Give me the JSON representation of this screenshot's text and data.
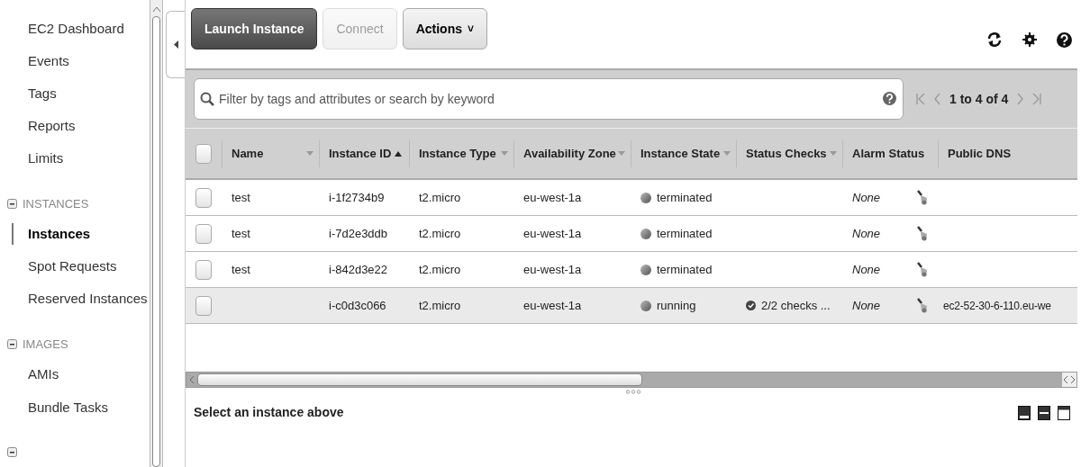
{
  "sidebar": {
    "items": [
      {
        "kind": "link",
        "label": "EC2 Dashboard",
        "selected": false
      },
      {
        "kind": "link",
        "label": "Events",
        "selected": false
      },
      {
        "kind": "link",
        "label": "Tags",
        "selected": false
      },
      {
        "kind": "link",
        "label": "Reports",
        "selected": false
      },
      {
        "kind": "link",
        "label": "Limits",
        "selected": false
      },
      {
        "kind": "group",
        "label": "INSTANCES",
        "expanded": true
      },
      {
        "kind": "link",
        "label": "Instances",
        "selected": true
      },
      {
        "kind": "link",
        "label": "Spot Requests",
        "selected": false
      },
      {
        "kind": "link",
        "label": "Reserved Instances",
        "selected": false
      },
      {
        "kind": "group",
        "label": "IMAGES",
        "expanded": true
      },
      {
        "kind": "link",
        "label": "AMIs",
        "selected": false
      },
      {
        "kind": "link",
        "label": "Bundle Tasks",
        "selected": false
      },
      {
        "kind": "group",
        "expanded": true
      }
    ]
  },
  "toolbar": {
    "buttons": [
      {
        "kind": "primary",
        "label": "Launch Instance",
        "disabled": false
      },
      {
        "kind": "plain",
        "label": "Connect",
        "disabled": true
      },
      {
        "kind": "menu",
        "label": "Actions",
        "caret": "˅",
        "disabled": false
      }
    ]
  },
  "filter": {
    "placeholder": "Filter by tags and attributes or search by keyword"
  },
  "pagination": {
    "label": "1 to 4 of 4"
  },
  "table": {
    "columns": [
      {
        "label": "Name",
        "sorted_ascending": false,
        "has_menu": true
      },
      {
        "label": "Instance ID",
        "sorted_ascending": true,
        "has_menu": false
      },
      {
        "label": "Instance Type",
        "sorted_ascending": false,
        "has_menu": true
      },
      {
        "label": "Availability Zone",
        "sorted_ascending": false,
        "has_menu": true
      },
      {
        "label": "Instance State",
        "sorted_ascending": false,
        "has_menu": true
      },
      {
        "label": "Status Checks",
        "sorted_ascending": false,
        "has_menu": true
      },
      {
        "label": "Alarm Status",
        "sorted_ascending": false,
        "has_menu": false
      },
      {
        "label": "Public DNS",
        "sorted_ascending": false,
        "has_menu": false
      }
    ],
    "select_all": {
      "checked": false
    },
    "rows": [
      {
        "highlighted": false,
        "checked": false,
        "name": "test",
        "id": "i-1f2734b9",
        "type": "t2.micro",
        "zone": "eu-west-1a",
        "state": "terminated",
        "alarm": "None"
      },
      {
        "highlighted": false,
        "checked": false,
        "name": "test",
        "id": "i-7d2e3ddb",
        "type": "t2.micro",
        "zone": "eu-west-1a",
        "state": "terminated",
        "alarm": "None"
      },
      {
        "highlighted": false,
        "checked": false,
        "name": "test",
        "id": "i-842d3e22",
        "type": "t2.micro",
        "zone": "eu-west-1a",
        "state": "terminated",
        "alarm": "None"
      },
      {
        "highlighted": true,
        "checked": false,
        "id": "i-c0d3c066",
        "type": "t2.micro",
        "zone": "eu-west-1a",
        "state": "running",
        "status_checks": "2/2 checks ...",
        "alarm": "None",
        "public_dns": "ec2-52-30-6-110.eu-we"
      }
    ]
  },
  "details": {
    "message": "Select an instance above"
  }
}
